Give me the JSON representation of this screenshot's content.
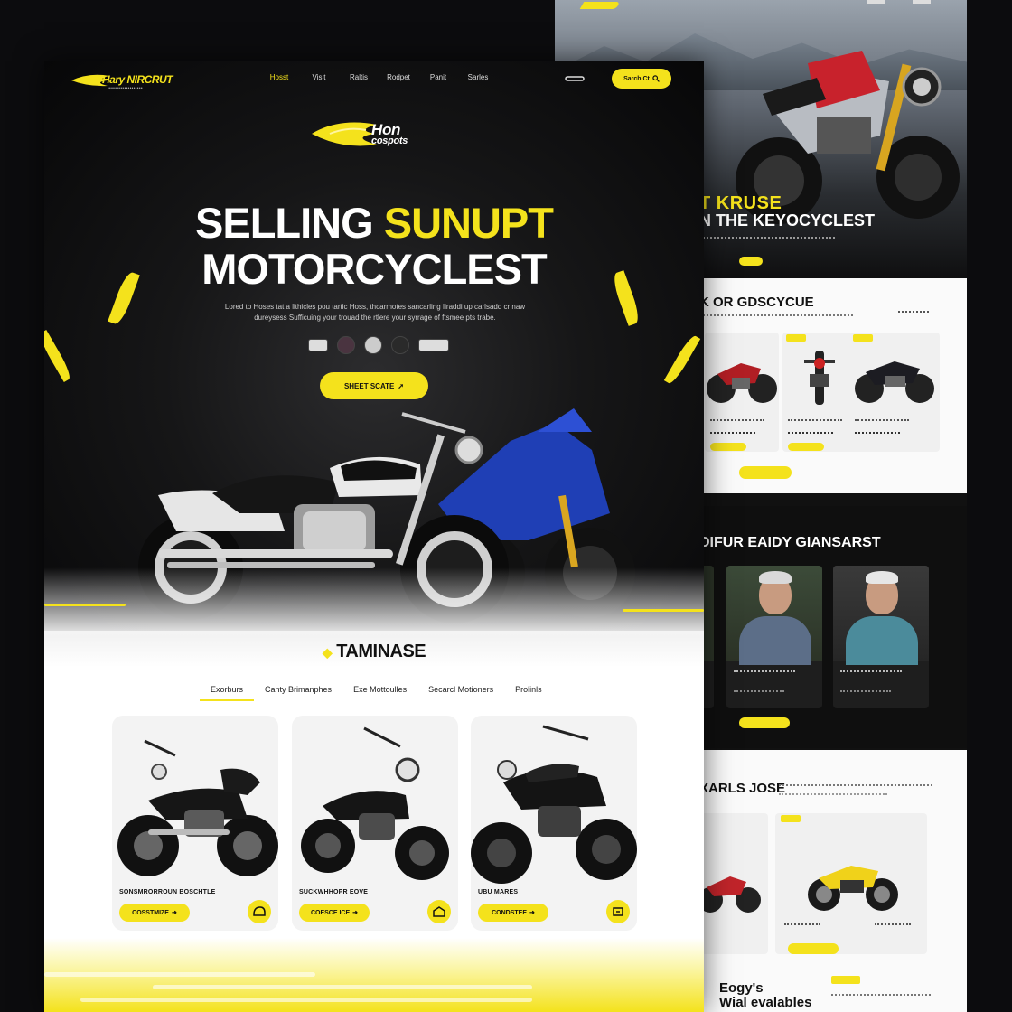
{
  "nav": {
    "brand": "Hary NIRCRUT",
    "items": [
      "Hosst",
      "Visit",
      "Raltis",
      "Rodpet",
      "Panit",
      "Sarles"
    ],
    "search_label": "Sarch Ct"
  },
  "hero": {
    "logo_line1": "Hon",
    "logo_line2": "cospots",
    "title_white": "SELLING",
    "title_yellow": "SUNUPT",
    "title_line2": "MOTORCYCLEST",
    "description": "Lored to Hoses tat a lithicles pou tartic Hoss, thcarmotes sancarling Iiraddi up carlsadd cr naw dureysess Sufficuing your trouad the rtlere your syrrage of ftsmee pts trabe.",
    "cta_label": "SHEET SCATE",
    "colors": {
      "accent": "#f4e21c",
      "dark": "#0c0c0e"
    }
  },
  "collection": {
    "title": "TAMINASE",
    "tabs": [
      "Exorburs",
      "Canty Brimanphes",
      "Exe Mottoulles",
      "Secarcl Motioners",
      "Prolinls"
    ],
    "active_tab": 0,
    "cards": [
      {
        "name": "SONSMRORROUN BOSCHTLE",
        "button": "COSSTMIZE",
        "icon": "helmet-icon"
      },
      {
        "name": "SUCKWHHOPR EOVE",
        "button": "COESCE ICE",
        "icon": "garage-icon"
      },
      {
        "name": "UBU MARES",
        "button": "CONDSTEE",
        "icon": "tag-icon"
      }
    ]
  },
  "side": {
    "hero_line1": "T KRUSE",
    "hero_line2": "N THE KEYOCYCLEST",
    "section2_title": "K OR GDSCYCUE",
    "section3_title": "DIFUR EAIDY GIANSARST",
    "section4_title": "XARLS JOSE",
    "footer_line1": "Eogy's",
    "footer_line2": "Wial evalables"
  }
}
